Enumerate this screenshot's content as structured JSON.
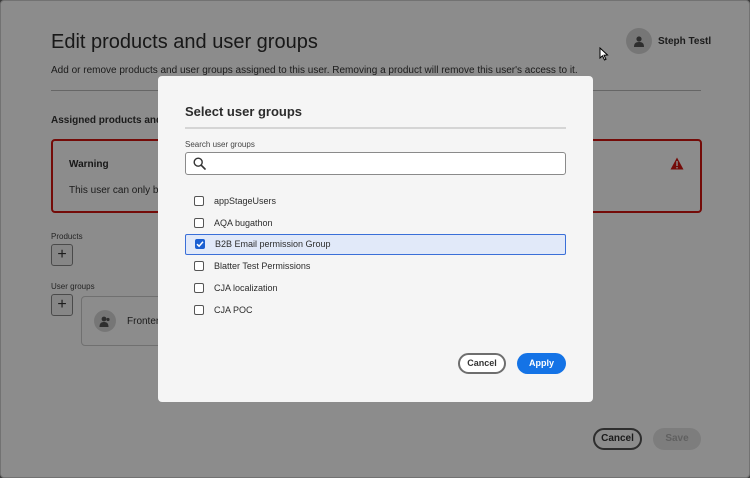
{
  "background": {
    "title": "Edit products and user groups",
    "subtitle": "Add or remove products and user groups assigned to this user. Removing a product will remove this user's access to it.",
    "user_name": "Steph Testl",
    "assigned_heading": "Assigned products and use",
    "warning": {
      "title": "Warning",
      "text": "This user can only be as"
    },
    "products_label": "Products",
    "user_groups_label": "User groups",
    "add_symbol": "+",
    "group_card_label": "Fronten",
    "cancel_label": "Cancel",
    "save_label": "Save"
  },
  "modal": {
    "title": "Select user groups",
    "search_label": "Search user groups",
    "search_value": "",
    "groups": [
      {
        "label": "appStageUsers",
        "checked": false
      },
      {
        "label": "AQA bugathon",
        "checked": false
      },
      {
        "label": "B2B Email permission Group",
        "checked": true
      },
      {
        "label": "Blatter Test Permissions",
        "checked": false
      },
      {
        "label": "CJA localization",
        "checked": false
      },
      {
        "label": "CJA POC",
        "checked": false
      }
    ],
    "cancel_label": "Cancel",
    "apply_label": "Apply"
  },
  "colors": {
    "accent": "#1473e6",
    "warning": "#d31510",
    "selected_row": "#e1e9f9"
  }
}
